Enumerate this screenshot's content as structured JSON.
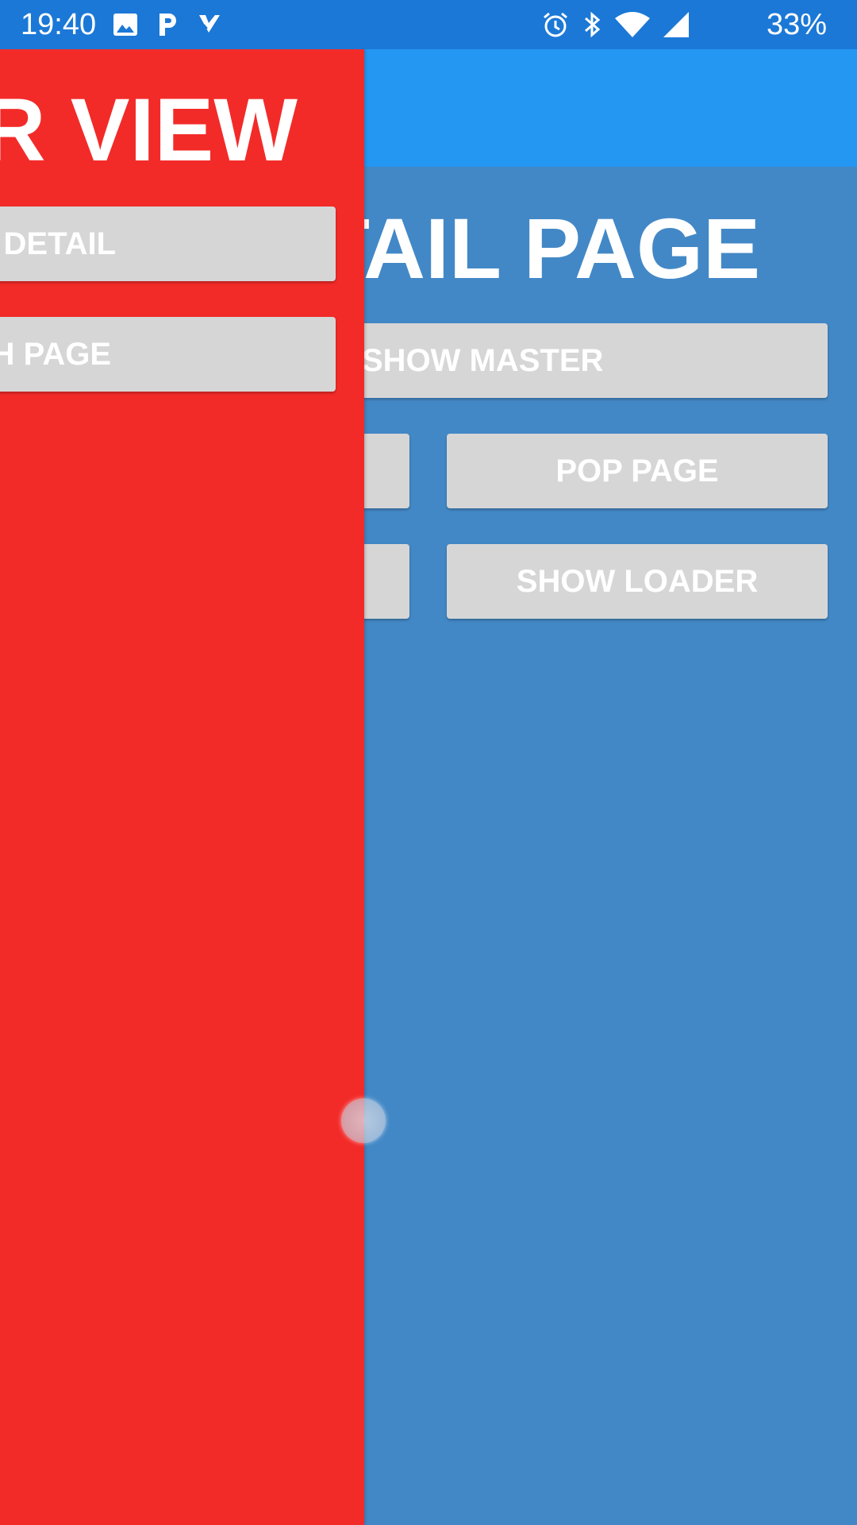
{
  "status_bar": {
    "time": "19:40",
    "battery": "33%",
    "left_icons": [
      "image-icon",
      "p-app-icon",
      "checkmark-app-icon"
    ],
    "right_icons": [
      "alarm-icon",
      "bluetooth-icon",
      "wifi-icon",
      "signal-icon"
    ]
  },
  "detail_page": {
    "title": "DETAIL PAGE",
    "buttons": {
      "show_master": "SHOW MASTER",
      "pop_page": "POP PAGE",
      "show_loader": "SHOW LOADER",
      "left_1": "",
      "left_2": ""
    }
  },
  "master_view": {
    "title": "MASTER VIEW",
    "buttons": {
      "show_detail": "SHOW DETAIL",
      "push_page": "PUSH PAGE"
    }
  },
  "colors": {
    "status_bar": "#1b78d6",
    "app_bar": "#2497f2",
    "detail_background": "#4388c6",
    "master_background": "#f22b29",
    "button": "#d6d6d6"
  }
}
